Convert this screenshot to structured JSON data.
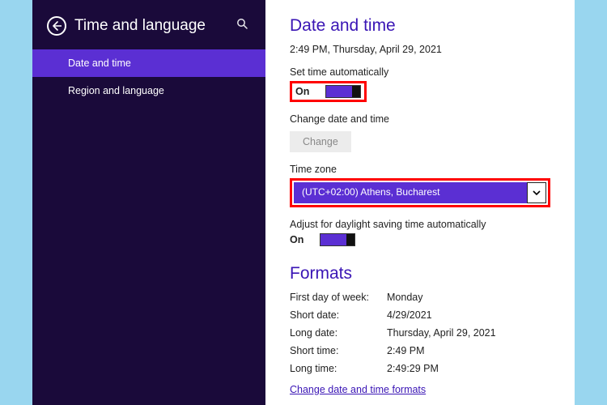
{
  "sidebar": {
    "title": "Time and language",
    "items": [
      {
        "label": "Date and time",
        "active": true
      },
      {
        "label": "Region and language",
        "active": false
      }
    ]
  },
  "main": {
    "heading": "Date and time",
    "current_time": "2:49 PM, Thursday, April 29, 2021",
    "set_auto": {
      "label": "Set time automatically",
      "state": "On"
    },
    "change": {
      "label": "Change date and time",
      "button": "Change"
    },
    "timezone": {
      "label": "Time zone",
      "value": "(UTC+02:00) Athens, Bucharest"
    },
    "dst": {
      "label": "Adjust for daylight saving time automatically",
      "state": "On"
    }
  },
  "formats": {
    "heading": "Formats",
    "rows": {
      "first_day_label": "First day of week:",
      "first_day_value": "Monday",
      "short_date_label": "Short date:",
      "short_date_value": "4/29/2021",
      "long_date_label": "Long date:",
      "long_date_value": "Thursday, April 29, 2021",
      "short_time_label": "Short time:",
      "short_time_value": "2:49 PM",
      "long_time_label": "Long time:",
      "long_time_value": "2:49:29 PM"
    },
    "link": "Change date and time formats"
  }
}
